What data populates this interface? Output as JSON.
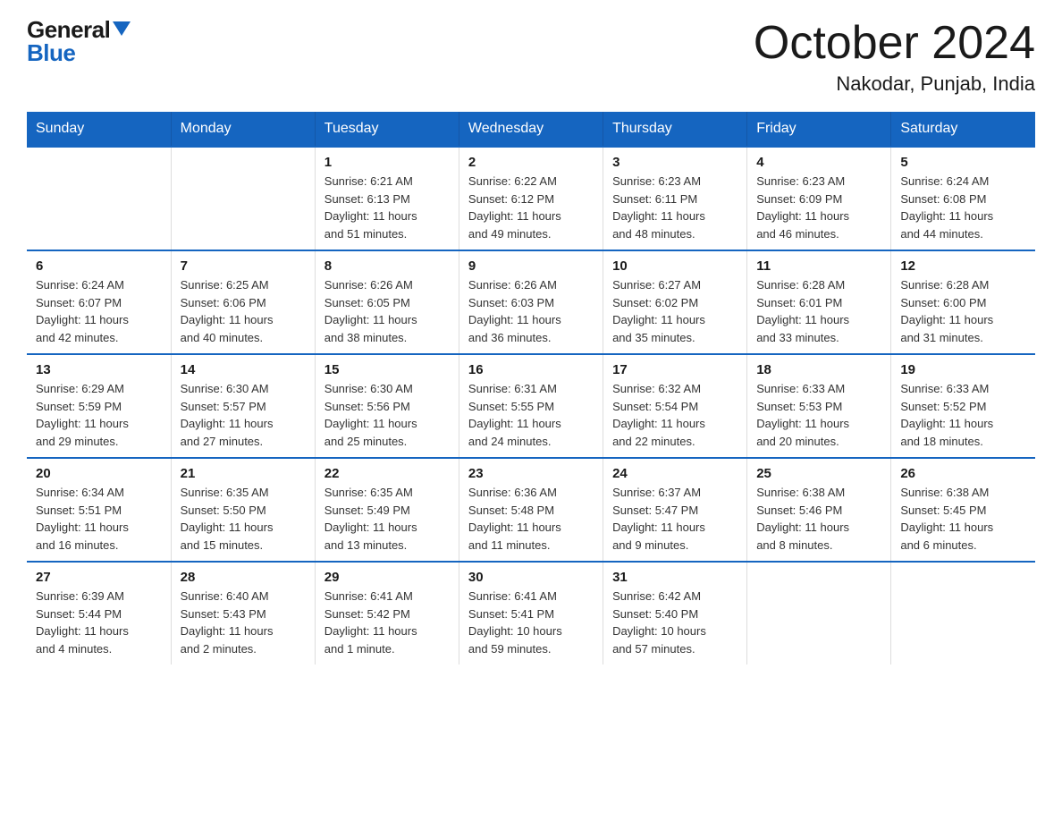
{
  "logo": {
    "general": "General",
    "blue": "Blue"
  },
  "title": "October 2024",
  "subtitle": "Nakodar, Punjab, India",
  "days_of_week": [
    "Sunday",
    "Monday",
    "Tuesday",
    "Wednesday",
    "Thursday",
    "Friday",
    "Saturday"
  ],
  "weeks": [
    [
      {
        "day": "",
        "info": ""
      },
      {
        "day": "",
        "info": ""
      },
      {
        "day": "1",
        "info": "Sunrise: 6:21 AM\nSunset: 6:13 PM\nDaylight: 11 hours\nand 51 minutes."
      },
      {
        "day": "2",
        "info": "Sunrise: 6:22 AM\nSunset: 6:12 PM\nDaylight: 11 hours\nand 49 minutes."
      },
      {
        "day": "3",
        "info": "Sunrise: 6:23 AM\nSunset: 6:11 PM\nDaylight: 11 hours\nand 48 minutes."
      },
      {
        "day": "4",
        "info": "Sunrise: 6:23 AM\nSunset: 6:09 PM\nDaylight: 11 hours\nand 46 minutes."
      },
      {
        "day": "5",
        "info": "Sunrise: 6:24 AM\nSunset: 6:08 PM\nDaylight: 11 hours\nand 44 minutes."
      }
    ],
    [
      {
        "day": "6",
        "info": "Sunrise: 6:24 AM\nSunset: 6:07 PM\nDaylight: 11 hours\nand 42 minutes."
      },
      {
        "day": "7",
        "info": "Sunrise: 6:25 AM\nSunset: 6:06 PM\nDaylight: 11 hours\nand 40 minutes."
      },
      {
        "day": "8",
        "info": "Sunrise: 6:26 AM\nSunset: 6:05 PM\nDaylight: 11 hours\nand 38 minutes."
      },
      {
        "day": "9",
        "info": "Sunrise: 6:26 AM\nSunset: 6:03 PM\nDaylight: 11 hours\nand 36 minutes."
      },
      {
        "day": "10",
        "info": "Sunrise: 6:27 AM\nSunset: 6:02 PM\nDaylight: 11 hours\nand 35 minutes."
      },
      {
        "day": "11",
        "info": "Sunrise: 6:28 AM\nSunset: 6:01 PM\nDaylight: 11 hours\nand 33 minutes."
      },
      {
        "day": "12",
        "info": "Sunrise: 6:28 AM\nSunset: 6:00 PM\nDaylight: 11 hours\nand 31 minutes."
      }
    ],
    [
      {
        "day": "13",
        "info": "Sunrise: 6:29 AM\nSunset: 5:59 PM\nDaylight: 11 hours\nand 29 minutes."
      },
      {
        "day": "14",
        "info": "Sunrise: 6:30 AM\nSunset: 5:57 PM\nDaylight: 11 hours\nand 27 minutes."
      },
      {
        "day": "15",
        "info": "Sunrise: 6:30 AM\nSunset: 5:56 PM\nDaylight: 11 hours\nand 25 minutes."
      },
      {
        "day": "16",
        "info": "Sunrise: 6:31 AM\nSunset: 5:55 PM\nDaylight: 11 hours\nand 24 minutes."
      },
      {
        "day": "17",
        "info": "Sunrise: 6:32 AM\nSunset: 5:54 PM\nDaylight: 11 hours\nand 22 minutes."
      },
      {
        "day": "18",
        "info": "Sunrise: 6:33 AM\nSunset: 5:53 PM\nDaylight: 11 hours\nand 20 minutes."
      },
      {
        "day": "19",
        "info": "Sunrise: 6:33 AM\nSunset: 5:52 PM\nDaylight: 11 hours\nand 18 minutes."
      }
    ],
    [
      {
        "day": "20",
        "info": "Sunrise: 6:34 AM\nSunset: 5:51 PM\nDaylight: 11 hours\nand 16 minutes."
      },
      {
        "day": "21",
        "info": "Sunrise: 6:35 AM\nSunset: 5:50 PM\nDaylight: 11 hours\nand 15 minutes."
      },
      {
        "day": "22",
        "info": "Sunrise: 6:35 AM\nSunset: 5:49 PM\nDaylight: 11 hours\nand 13 minutes."
      },
      {
        "day": "23",
        "info": "Sunrise: 6:36 AM\nSunset: 5:48 PM\nDaylight: 11 hours\nand 11 minutes."
      },
      {
        "day": "24",
        "info": "Sunrise: 6:37 AM\nSunset: 5:47 PM\nDaylight: 11 hours\nand 9 minutes."
      },
      {
        "day": "25",
        "info": "Sunrise: 6:38 AM\nSunset: 5:46 PM\nDaylight: 11 hours\nand 8 minutes."
      },
      {
        "day": "26",
        "info": "Sunrise: 6:38 AM\nSunset: 5:45 PM\nDaylight: 11 hours\nand 6 minutes."
      }
    ],
    [
      {
        "day": "27",
        "info": "Sunrise: 6:39 AM\nSunset: 5:44 PM\nDaylight: 11 hours\nand 4 minutes."
      },
      {
        "day": "28",
        "info": "Sunrise: 6:40 AM\nSunset: 5:43 PM\nDaylight: 11 hours\nand 2 minutes."
      },
      {
        "day": "29",
        "info": "Sunrise: 6:41 AM\nSunset: 5:42 PM\nDaylight: 11 hours\nand 1 minute."
      },
      {
        "day": "30",
        "info": "Sunrise: 6:41 AM\nSunset: 5:41 PM\nDaylight: 10 hours\nand 59 minutes."
      },
      {
        "day": "31",
        "info": "Sunrise: 6:42 AM\nSunset: 5:40 PM\nDaylight: 10 hours\nand 57 minutes."
      },
      {
        "day": "",
        "info": ""
      },
      {
        "day": "",
        "info": ""
      }
    ]
  ]
}
